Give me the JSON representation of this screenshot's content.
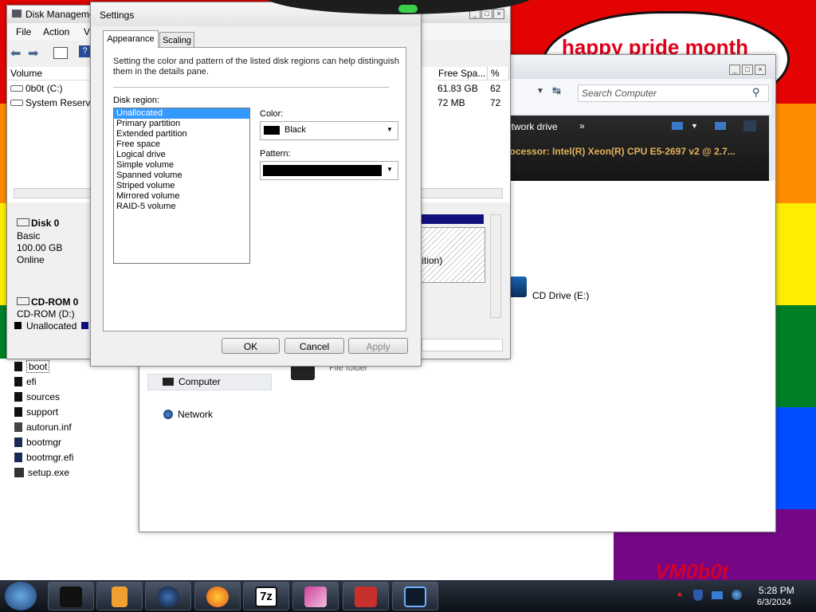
{
  "wallpaper": {
    "bubble_text": "happy pride month",
    "watermark": "VM0b0t",
    "colors": [
      "#e40303",
      "#ff8c00",
      "#ffed00",
      "#008026",
      "#004dff",
      "#750787"
    ]
  },
  "disk_mgmt": {
    "title": "Disk Manageme",
    "menu": [
      "File",
      "Action",
      "V"
    ],
    "columns": {
      "volume": "Volume",
      "free": "Free Spa...",
      "pct": "%"
    },
    "volumes": [
      {
        "name": "0b0t (C:)",
        "free": "61.83 GB",
        "pct": "62"
      },
      {
        "name": "System Reserve",
        "free": "72 MB",
        "pct": "72"
      }
    ],
    "disk0": {
      "name": "Disk 0",
      "type": "Basic",
      "size": "100.00 GB",
      "status": "Online"
    },
    "cdrom": {
      "name": "CD-ROM 0",
      "sub": "CD-ROM (D:)",
      "legend": "Unallocated"
    },
    "partition_text": "rtition)"
  },
  "settings": {
    "title": "Settings",
    "tabs": [
      "Appearance",
      "Scaling"
    ],
    "description": "Setting the color and pattern of the listed disk regions can help distinguish them in the details pane.",
    "region_label": "Disk region:",
    "regions": [
      "Unallocated",
      "Primary partition",
      "Extended partition",
      "Free space",
      "Logical drive",
      "Simple volume",
      "Spanned volume",
      "Striped volume",
      "Mirrored volume",
      "RAID-5 volume"
    ],
    "color_label": "Color:",
    "color_value": "Black",
    "pattern_label": "Pattern:",
    "ok": "OK",
    "cancel": "Cancel",
    "apply": "Apply"
  },
  "explorer": {
    "search_placeholder": "Search Computer",
    "toolbar_text": "etwork drive",
    "processor_text": "rocessor: Intel(R) Xeon(R) CPU E5-2697 v2 @ 2.7...",
    "cd_drive": "CD Drive (E:)",
    "file_folder": "File folder",
    "nav_computer": "Computer",
    "nav_network": "Network"
  },
  "files": [
    "boot",
    "efi",
    "sources",
    "support",
    "autorun.inf",
    "bootmgr",
    "bootmgr.efi",
    "setup.exe"
  ],
  "taskbar": {
    "time": "5:28 PM",
    "date": "6/3/2024",
    "seven_zip": "7z"
  }
}
